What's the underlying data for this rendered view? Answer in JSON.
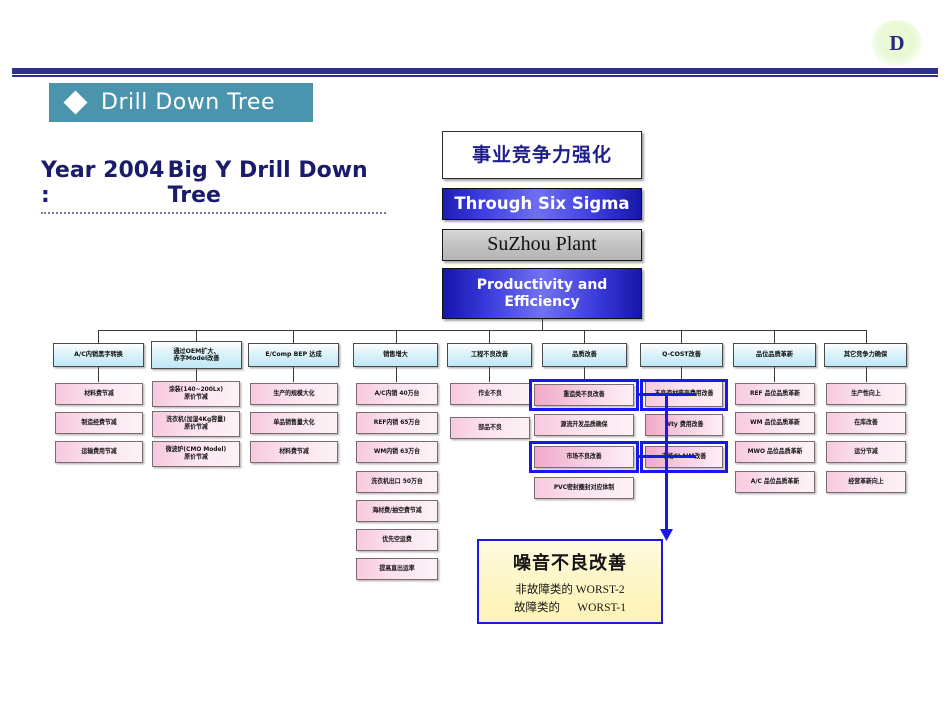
{
  "header": {
    "logo_letter": "D"
  },
  "title": {
    "chip_label": "Drill Down Tree",
    "year_label": "Year 2004 :",
    "subject_label": "Big Y Drill Down Tree"
  },
  "top_stack": [
    {
      "label": "事业竞争力强化",
      "style": "white"
    },
    {
      "label": "Through Six Sigma",
      "style": "blue"
    },
    {
      "label": "SuZhou Plant",
      "style": "gray"
    },
    {
      "label": "Productivity and Efficiency",
      "style": "blue2"
    }
  ],
  "columns": [
    {
      "header": "A/C内销黑字转换",
      "items": [
        "材料费节减",
        "制造经费节减",
        "运输费用节减"
      ]
    },
    {
      "header": "通过OEM扩大、\n赤字Model改善",
      "items": [
        "涂装(140~200Lx)\n原价节减",
        "洗衣机(加湿4Kg容量)\n原价节减",
        "微波炉(CMO Model)\n原价节减"
      ]
    },
    {
      "header": "E/Comp BEP 达成",
      "items": [
        "生产的规模大化",
        "单品销售量大化",
        "材料费节减"
      ]
    },
    {
      "header": "销售增大",
      "items": [
        "A/C内销 40万台",
        "REF内销 65万台",
        "WM内销 63万台",
        "洗衣机出口 50万台",
        "海材费/抽空费节减",
        "优先空运费",
        "提高直出运率"
      ]
    },
    {
      "header": "工程不良改善",
      "items": [
        "作业不良",
        "部品不良"
      ]
    },
    {
      "header": "品质改善",
      "items": [
        "重造类不良改善",
        "源流开发品质确保",
        "市场不良改善",
        "PVC密封圈封对应体制"
      ]
    },
    {
      "header": "Q-COST改善",
      "items": [
        "不良资材废弃费用改善",
        "Wty 费用改善",
        "市场CLAIM改善"
      ]
    },
    {
      "header": "品位品质革新",
      "items": [
        "REF 品位品质革新",
        "WM 品位品质革新",
        "MWO 品位品质革新",
        "A/C 品位品质革新"
      ]
    },
    {
      "header": "其它竞争力确保",
      "items": [
        "生产性向上",
        "在库改善",
        "运分节减",
        "经营革新向上"
      ]
    }
  ],
  "callout": {
    "title": "噪音不良改善",
    "line1": "非故障类的 WORST-2",
    "line2": "故障类的      WORST-1"
  },
  "colors": {
    "chip_bg": "#4a94ad",
    "rule": "#2e3192",
    "highlight": "#1818e8",
    "callout_bg": "#fdf3b6",
    "cat_bg": "#bfe9f6",
    "leaf_bg": "#f7c9de"
  }
}
